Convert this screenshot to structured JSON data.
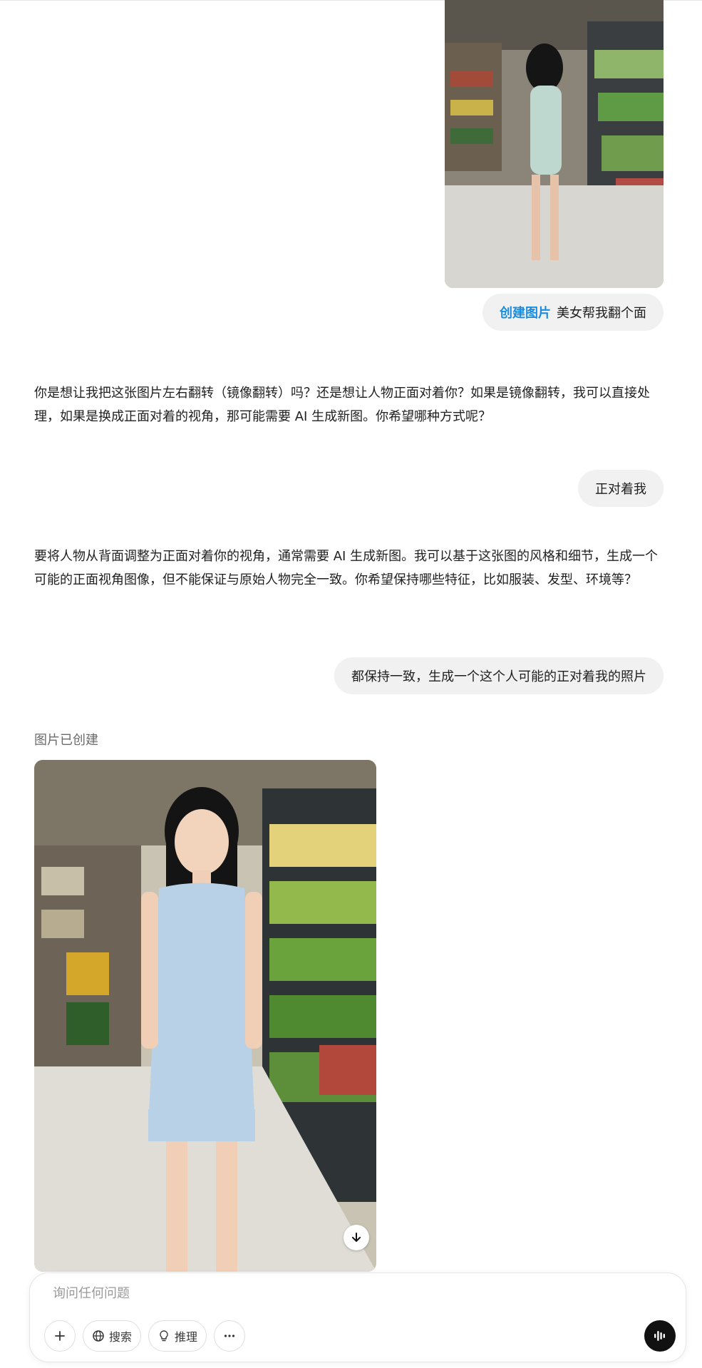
{
  "messages": {
    "user_1": {
      "tag": "创建图片",
      "text": "美女帮我翻个面"
    },
    "assistant_1": "你是想让我把这张图片左右翻转（镜像翻转）吗？还是想让人物正面对着你？如果是镜像翻转，我可以直接处理，如果是换成正面对着的视角，那可能需要 AI 生成新图。你希望哪种方式呢？",
    "user_2": "正对着我",
    "assistant_2": "要将人物从背面调整为正面对着你的视角，通常需要 AI 生成新图。我可以基于这张图的风格和细节，生成一个可能的正面视角图像，但不能保证与原始人物完全一致。你希望保持哪些特征，比如服装、发型、环境等？",
    "user_3": "都保持一致，生成一个这个人可能的正对着我的照片",
    "status": "图片已创建"
  },
  "composer": {
    "placeholder": "询问任何问题",
    "search_label": "搜索",
    "reason_label": "推理"
  },
  "icons": [
    "download-icon",
    "plus-icon",
    "globe-icon",
    "lightbulb-icon",
    "more-icon",
    "voice-icon"
  ],
  "colors": {
    "accent": "#1a8cdf",
    "bubble": "#f1f1f1"
  }
}
